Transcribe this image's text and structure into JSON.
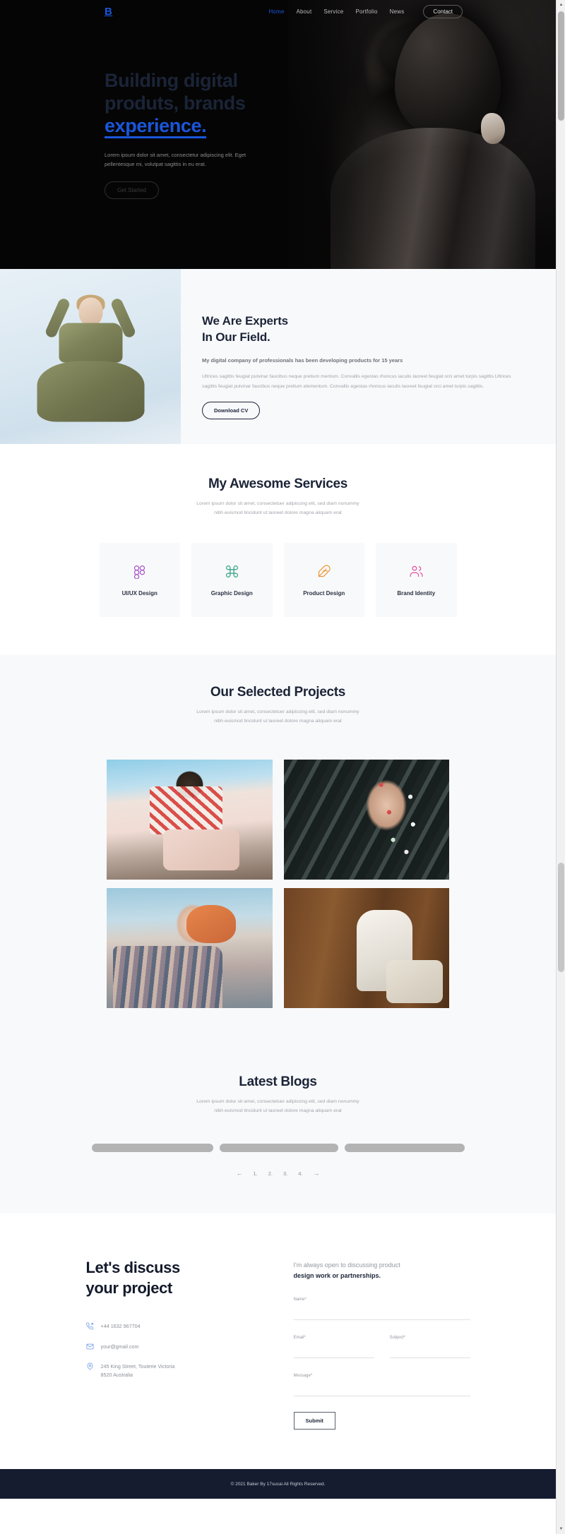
{
  "navbar": {
    "logo": "B",
    "links": [
      {
        "label": "Home",
        "active": true
      },
      {
        "label": "About",
        "active": false
      },
      {
        "label": "Service",
        "active": false
      },
      {
        "label": "Portfolio",
        "active": false
      },
      {
        "label": "News",
        "active": false
      }
    ],
    "cta_label": "Contact"
  },
  "hero": {
    "heading_line1": "Building digital",
    "heading_line2": "produts, brands",
    "heading_accent": "experience.",
    "subtext": "Lorem ipsum dolor sit amet, consectetur adipiscing elit. Eget pellentesque mi, volutpat sagittis in eu erat.",
    "button_label": "Get Started",
    "accent_color": "#1a56db",
    "background_color": "#050505"
  },
  "about": {
    "heading_line1": "We Are Experts",
    "heading_line2": "In Our Field.",
    "lead": "My digital company of professionals has been developing products for 15 years",
    "body": "Ultrices sagittis feugiat pulvinar faucibus neque pretium mentum. Convallis egestas rhoncus iaculis laoreet feugiat orci amet turpis sagittis.Ultrices sagittis feugiat pulvinar faucibus neque pretium elementum. Convallis egestas rhoncus iaculis laoreet feugiat orci amet turpis sagittis.",
    "button_label": "Download CV"
  },
  "services": {
    "title": "My Awesome Services",
    "subtitle_line1": "Lorem ipsum dolor sit amet, consectetuer adipiscing elit, sed diam nonummy",
    "subtitle_line2": "nibh euismod tincidunt ut laoreet dolore magna aliquam erat",
    "cards": [
      {
        "label": "UI/UX Design",
        "icon": "figma-icon",
        "color": "#a855c7"
      },
      {
        "label": "Graphic Design",
        "icon": "command-icon",
        "color": "#2e9e82"
      },
      {
        "label": "Product Design",
        "icon": "feather-icon",
        "color": "#eb9834"
      },
      {
        "label": "Brand Identity",
        "icon": "users-icon",
        "color": "#e0509b"
      }
    ]
  },
  "projects": {
    "title": "Our Selected Projects",
    "subtitle_line1": "Lorem ipsum dolor sit amet, consectetuer adipiscing elit, sed diam nonummy",
    "subtitle_line2": "nibh euismod tincidunt ut laoreet dolore magna aliquam erat",
    "items": [
      {
        "name": "project-street-portrait"
      },
      {
        "name": "project-floral-dancer"
      },
      {
        "name": "project-pastel-portrait"
      },
      {
        "name": "project-white-outfit"
      }
    ]
  },
  "blogs": {
    "title": "Latest Blogs",
    "subtitle_line1": "Lorem ipsum dolor sit amet, consectetuer adipiscing elit, sed diam nonummy",
    "subtitle_line2": "nibh euismod tincidunt ut laoreet dolore magna aliquam erat",
    "placeholder_count": 3,
    "pagination": {
      "prev": "←",
      "pages": [
        "1.",
        "2.",
        "3.",
        "4."
      ],
      "next": "→"
    }
  },
  "contact": {
    "heading_line1": "Let's discuss",
    "heading_line2": "your project",
    "phone": "+44 1632 967704",
    "email": "your@gmail.com",
    "address_line1": "245 King Street, Touterie Victoria",
    "address_line2": "8520 Australia",
    "form_intro_1": "I'm always open to discussing product",
    "form_intro_2": "design work or partnerships.",
    "fields": {
      "name_label": "Name*",
      "name_value": "",
      "name_placeholder": "",
      "email_label": "Email*",
      "email_value": "",
      "email_placeholder": "",
      "subject_label": "Subject*",
      "subject_value": "",
      "subject_placeholder": "",
      "message_label": "Message*",
      "message_value": "",
      "message_placeholder": ""
    },
    "submit_label": "Submit"
  },
  "footer": {
    "text": "© 2021 Baker By 17sucai All Rights Reserved.",
    "background_color": "#151c30"
  },
  "scrollbar": {
    "up_arrow": "▲",
    "down_arrow": "▼"
  }
}
